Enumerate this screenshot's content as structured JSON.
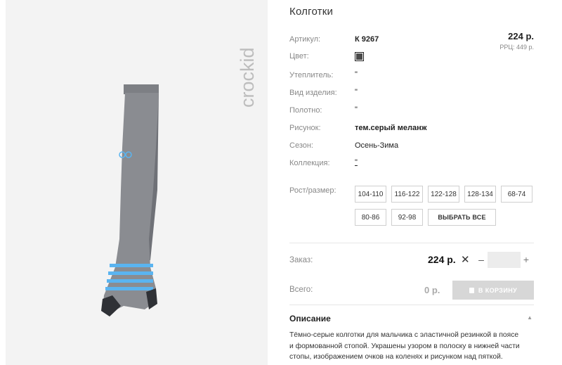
{
  "product": {
    "title": "Колготки",
    "brand": "crockid"
  },
  "attributes": [
    {
      "label": "Артикул:",
      "value": "К 9267",
      "bold": true
    },
    {
      "label": "Цвет:",
      "value": ""
    },
    {
      "label": "Утеплитель:",
      "value": "\""
    },
    {
      "label": "Вид изделия:",
      "value": "\""
    },
    {
      "label": "Полотно:",
      "value": "\""
    },
    {
      "label": "Рисунок:",
      "value": "тем.серый меланж",
      "bold": true
    },
    {
      "label": "Сезон:",
      "value": "Осень-Зима"
    },
    {
      "label": "Коллекция:",
      "value": "\""
    }
  ],
  "color_swatch": {
    "color": "#4a4a4a",
    "icon": "color-swatch-icon"
  },
  "pricing": {
    "price": "224 р.",
    "rrp": "РРЦ: 449 р."
  },
  "sizes": {
    "label": "Рост/размер:",
    "options": [
      "104-110",
      "116-122",
      "122-128",
      "128-134",
      "68-74",
      "80-86",
      "92-98"
    ],
    "select_all": "ВЫБРАТЬ ВСЕ"
  },
  "order": {
    "label": "Заказ:",
    "price": "224 р.",
    "times": "✕",
    "minus": "–",
    "quantity": "",
    "plus": "+"
  },
  "total": {
    "label": "Всего:",
    "value": "0 р.",
    "cart_button": "В КОРЗИНУ"
  },
  "description": {
    "title": "Описание",
    "toggle_icon": "▲",
    "text_lines": [
      "Тёмно-серые колготки для мальчика с эластичной резинкой в поясе",
      "и формованной стопой. Украшены узором в полоску в нижней части",
      "стопы, изображением очков на коленях и рисунком над пяткой."
    ]
  }
}
